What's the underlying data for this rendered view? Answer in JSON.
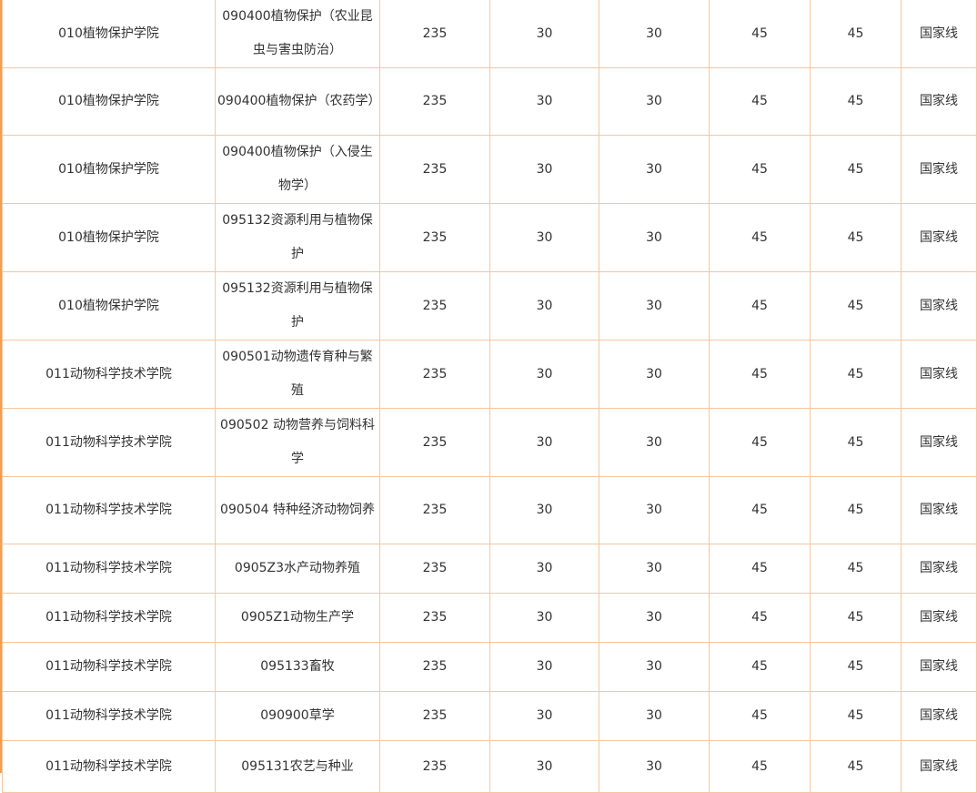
{
  "table": {
    "rows": [
      {
        "college": "010植物保护学院",
        "major": "090400植物保护（农业昆虫与害虫防治）",
        "total": "235",
        "s1": "30",
        "s2": "30",
        "s3": "45",
        "s4": "45",
        "line": "国家线"
      },
      {
        "college": "010植物保护学院",
        "major": "090400植物保护（农药学）",
        "total": "235",
        "s1": "30",
        "s2": "30",
        "s3": "45",
        "s4": "45",
        "line": "国家线"
      },
      {
        "college": "010植物保护学院",
        "major": "090400植物保护（入侵生物学）",
        "total": "235",
        "s1": "30",
        "s2": "30",
        "s3": "45",
        "s4": "45",
        "line": "国家线"
      },
      {
        "college": "010植物保护学院",
        "major": "095132资源利用与植物保护",
        "total": "235",
        "s1": "30",
        "s2": "30",
        "s3": "45",
        "s4": "45",
        "line": "国家线"
      },
      {
        "college": "010植物保护学院",
        "major": "095132资源利用与植物保护",
        "total": "235",
        "s1": "30",
        "s2": "30",
        "s3": "45",
        "s4": "45",
        "line": "国家线"
      },
      {
        "college": "011动物科学技术学院",
        "major": "090501动物遗传育种与繁殖",
        "total": "235",
        "s1": "30",
        "s2": "30",
        "s3": "45",
        "s4": "45",
        "line": "国家线"
      },
      {
        "college": "011动物科学技术学院",
        "major": "090502 动物营养与饲料科学",
        "total": "235",
        "s1": "30",
        "s2": "30",
        "s3": "45",
        "s4": "45",
        "line": "国家线"
      },
      {
        "college": "011动物科学技术学院",
        "major": "090504 特种经济动物饲养",
        "total": "235",
        "s1": "30",
        "s2": "30",
        "s3": "45",
        "s4": "45",
        "line": "国家线"
      },
      {
        "college": "011动物科学技术学院",
        "major": "0905Z3水产动物养殖",
        "total": "235",
        "s1": "30",
        "s2": "30",
        "s3": "45",
        "s4": "45",
        "line": "国家线"
      },
      {
        "college": "011动物科学技术学院",
        "major": "0905Z1动物生产学",
        "total": "235",
        "s1": "30",
        "s2": "30",
        "s3": "45",
        "s4": "45",
        "line": "国家线"
      },
      {
        "college": "011动物科学技术学院",
        "major": "095133畜牧",
        "total": "235",
        "s1": "30",
        "s2": "30",
        "s3": "45",
        "s4": "45",
        "line": "国家线"
      },
      {
        "college": "011动物科学技术学院",
        "major": "090900草学",
        "total": "235",
        "s1": "30",
        "s2": "30",
        "s3": "45",
        "s4": "45",
        "line": "国家线"
      },
      {
        "college": "011动物科学技术学院",
        "major": "095131农艺与种业",
        "total": "235",
        "s1": "30",
        "s2": "30",
        "s3": "45",
        "s4": "45",
        "line": "国家线"
      }
    ]
  },
  "colors": {
    "border": "#f5c6a0",
    "accent_left": "#f0a050",
    "text": "#333333"
  }
}
